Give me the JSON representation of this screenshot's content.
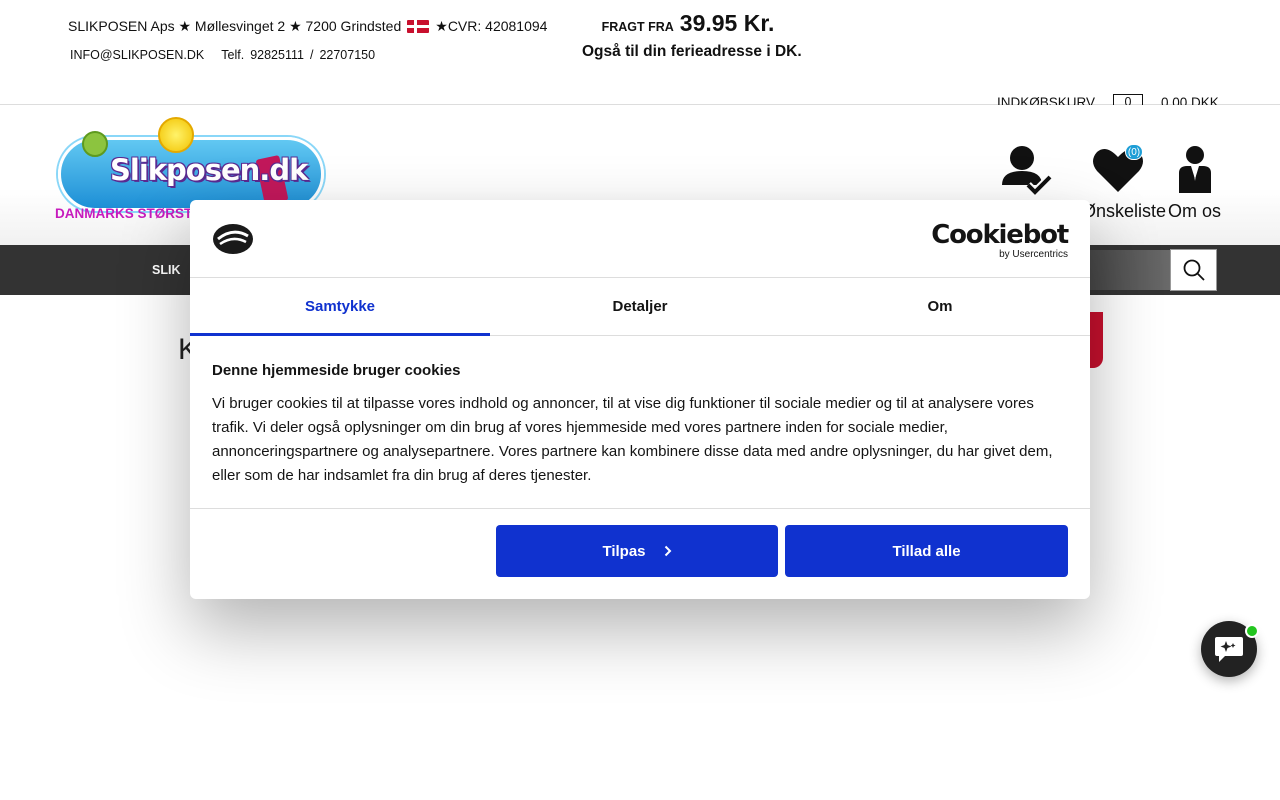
{
  "topbar": {
    "company": "SLIKPOSEN Aps ★ Møllesvinget 2 ★ 7200 Grindsted",
    "cvr": "★CVR: 42081094",
    "email": "INFO@SLIKPOSEN.DK",
    "phone_label": "Telf.",
    "phone1": "92825111",
    "phone_sep": "/",
    "phone2": "22707150",
    "shipping_label": "FRAGT FRA",
    "shipping_price": "39.95 Kr.",
    "shipping_sub": "Også til din ferieadresse i DK."
  },
  "cart": {
    "label": "INDKØBSKURV",
    "count": "0",
    "total": "0,00 DKK"
  },
  "header": {
    "logo_text": "Slikposen.dk",
    "tagline": "DANMARKS STØRST",
    "wishlist_label": "Ønskeliste",
    "wishlist_count": "(0)",
    "about_label": "Om os"
  },
  "nav": {
    "first_item": "SLIK"
  },
  "content": {
    "heading_fragment": "K"
  },
  "cookie": {
    "brand": "Cookiebot",
    "brand_by": "by Usercentrics",
    "tabs": [
      "Samtykke",
      "Detaljer",
      "Om"
    ],
    "title": "Denne hjemmeside bruger cookies",
    "text": "Vi bruger cookies til at tilpasse vores indhold og annoncer, til at vise dig funktioner til sociale medier og til at analysere vores trafik. Vi deler også oplysninger om din brug af vores hjemmeside med vores partnere inden for sociale medier, annonceringspartnere og analysepartnere. Vores partnere kan kombinere disse data med andre oplysninger, du har givet dem, eller som de har indsamlet fra din brug af deres tjenester.",
    "customize_label": "Tilpas",
    "allow_all_label": "Tillad alle"
  },
  "colors": {
    "accent": "#1032cf",
    "tagline": "#c71bbd",
    "nav_bg": "#333333",
    "online": "#22c51f"
  }
}
